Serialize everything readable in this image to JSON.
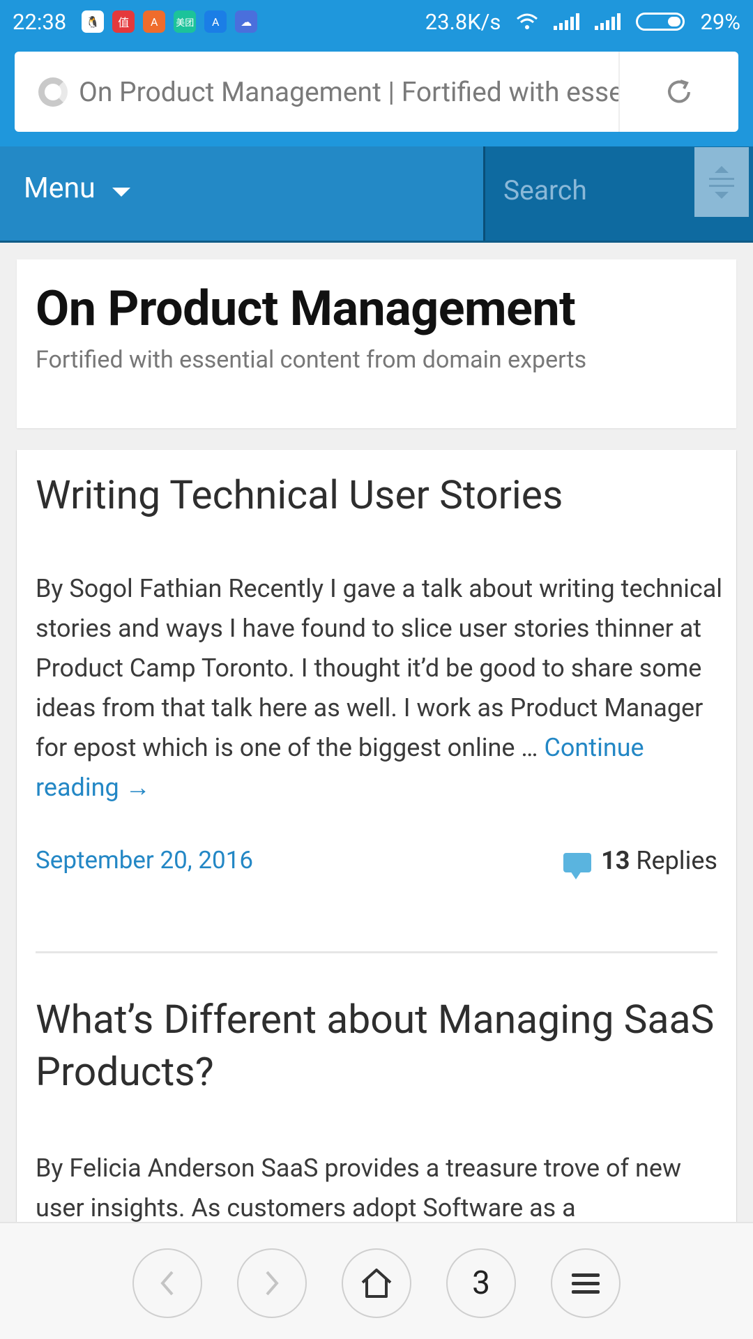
{
  "status_bar": {
    "time": "22:38",
    "network_speed": "23.8K/s",
    "battery": "29%",
    "apps": [
      {
        "icon": "qq-icon",
        "glyph": "🐧",
        "color": "#ffffff"
      },
      {
        "icon": "zhi-icon",
        "glyph": "值",
        "color": "#e4393c"
      },
      {
        "icon": "app-store-icon",
        "glyph": "A",
        "color": "#ef6c2c"
      },
      {
        "icon": "meituan-icon",
        "glyph": "美团",
        "color": "#1cc39a"
      },
      {
        "icon": "translate-icon",
        "glyph": "A",
        "color": "#1b7ee6"
      },
      {
        "icon": "cloud-icon",
        "glyph": "☁",
        "color": "#4a6fdc"
      }
    ]
  },
  "browser": {
    "url_title": "On Product Management | Fortified with essential content from domain experts",
    "tab_count": "3"
  },
  "site_nav": {
    "menu_label": "Menu",
    "search_placeholder": "Search"
  },
  "site": {
    "title": "On Product Management",
    "description": "Fortified with essential content from domain experts"
  },
  "posts": [
    {
      "title": "Writing Technical User Stories",
      "excerpt": "By Sogol Fathian Recently I gave a talk about writing technical stories and ways I have found to slice user stories thinner at Product Camp Toronto. I thought it’d be good to share some ideas from that talk here as well. I work as Product Manager for epost which is one of the biggest online … ",
      "continue_label": "Continue reading →",
      "date": "September 20, 2016",
      "reply_count": "13",
      "reply_label": " Replies"
    },
    {
      "title": "What’s Different about Managing SaaS Products?",
      "excerpt": "By Felicia Anderson SaaS provides a treasure trove of new user insights. As customers adopt Software as a"
    }
  ],
  "colors": {
    "accent": "#1f97dc",
    "nav": "#2389c6",
    "link": "#2387c5"
  }
}
